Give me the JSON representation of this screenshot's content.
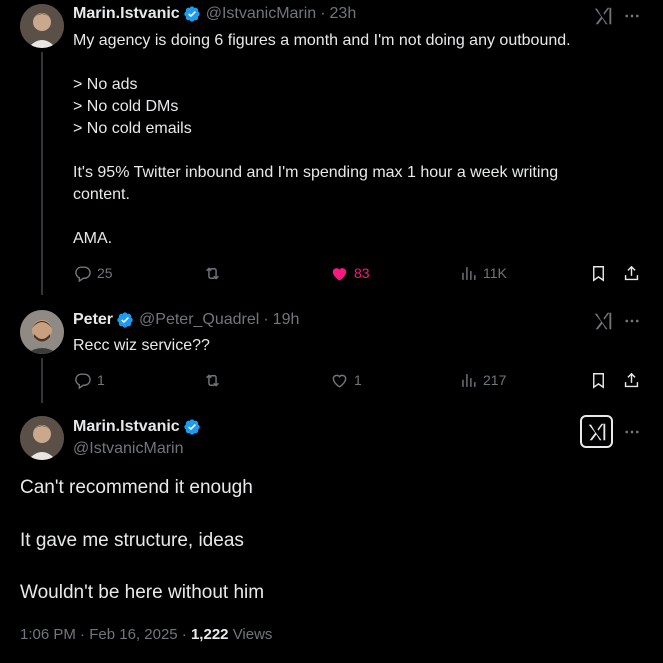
{
  "tweet1": {
    "name": "Marin.Istvanic",
    "handle": "@IstvanicMarin",
    "separator": "·",
    "time": "23h",
    "lines": [
      "My agency is doing 6 figures a month and I'm not doing any outbound.",
      "",
      "> No ads",
      "> No cold DMs",
      "> No cold emails",
      "",
      "It's 95% Twitter inbound and I'm spending max 1 hour a week writing",
      "content.",
      "",
      "AMA."
    ],
    "replies": "25",
    "reposts": "",
    "likes": "83",
    "views": "11K"
  },
  "tweet2": {
    "name": "Peter",
    "handle": "@Peter_Quadrel",
    "separator": "·",
    "time": "19h",
    "text": "Recc wiz service??",
    "replies": "1",
    "reposts": "",
    "likes": "1",
    "views": "217"
  },
  "main": {
    "name": "Marin.Istvanic",
    "handle": "@IstvanicMarin",
    "lines": [
      "Can't recommend it enough",
      "It gave me structure, ideas",
      "Wouldn't be here without him"
    ],
    "time": "1:06 PM",
    "separator": "·",
    "date": "Feb 16, 2025",
    "views_count": "1,222",
    "views_label": "Views"
  },
  "colors": {
    "background": "#000000",
    "text": "#e7e9ea",
    "muted": "#71767b",
    "verified": "#1d9bf0",
    "like_active": "#f91880",
    "thread_line": "#333639"
  },
  "icons": [
    "verified-badge-icon",
    "grok-icon",
    "more-icon",
    "reply-icon",
    "repost-icon",
    "like-icon",
    "views-icon",
    "bookmark-icon",
    "share-icon"
  ]
}
